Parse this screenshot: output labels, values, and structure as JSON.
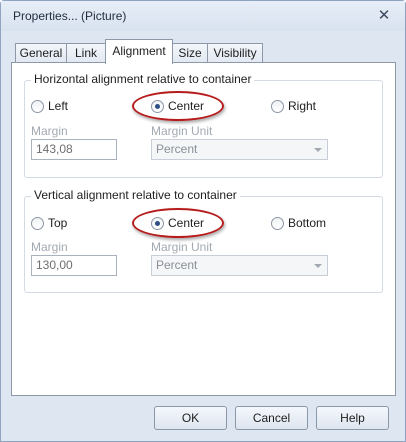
{
  "window": {
    "title": "Properties... (Picture)"
  },
  "tabs": [
    {
      "label": "General"
    },
    {
      "label": "Link"
    },
    {
      "label": "Alignment"
    },
    {
      "label": "Size"
    },
    {
      "label": "Visibility"
    }
  ],
  "horizontal": {
    "title": "Horizontal alignment relative to container",
    "options": [
      {
        "label": "Left",
        "checked": false
      },
      {
        "label": "Center",
        "checked": true
      },
      {
        "label": "Right",
        "checked": false
      }
    ],
    "margin_label": "Margin",
    "margin_value": "143,08",
    "unit_label": "Margin Unit",
    "unit_value": "Percent"
  },
  "vertical": {
    "title": "Vertical alignment relative to container",
    "options": [
      {
        "label": "Top",
        "checked": false
      },
      {
        "label": "Center",
        "checked": true
      },
      {
        "label": "Bottom",
        "checked": false
      }
    ],
    "margin_label": "Margin",
    "margin_value": "130,00",
    "unit_label": "Margin Unit",
    "unit_value": "Percent"
  },
  "buttons": {
    "ok": "OK",
    "cancel": "Cancel",
    "help": "Help"
  },
  "icons": {
    "close": "close-icon",
    "dropdown": "chevron-down-icon"
  },
  "colors": {
    "highlight_ellipse": "#b71c1c",
    "active_radio": "#2d4f84"
  }
}
